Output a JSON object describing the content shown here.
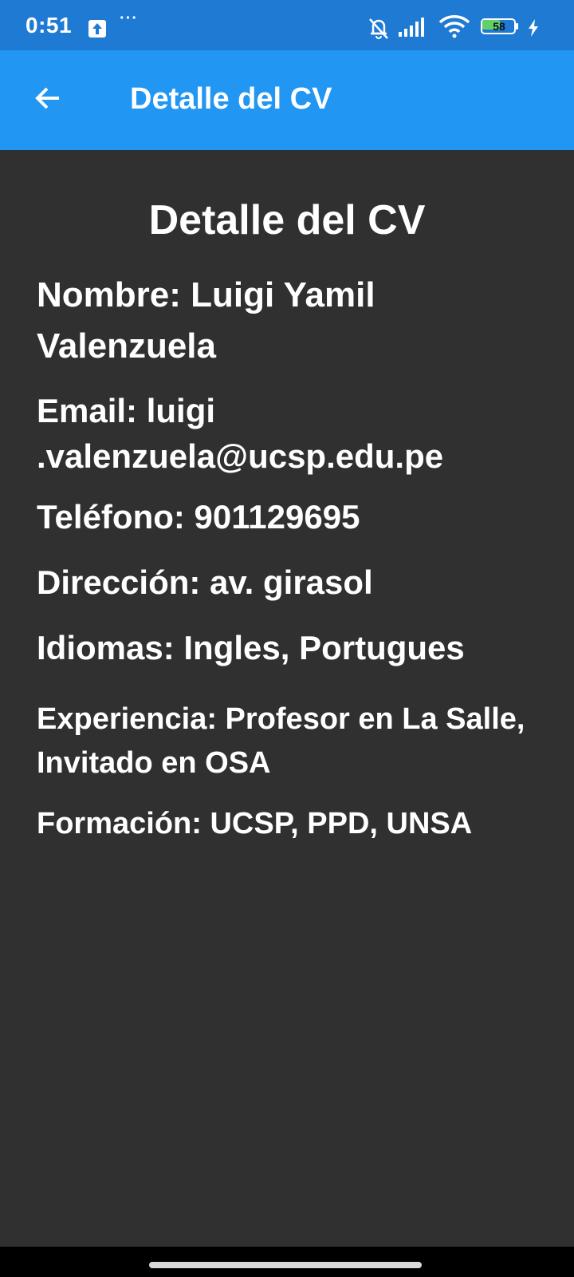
{
  "status_bar": {
    "time": "0:51",
    "battery_level": "58",
    "icons": [
      "upload-icon",
      "more-icon",
      "notifications-off-icon",
      "signal-icon",
      "wifi-icon",
      "battery-icon",
      "charging-icon"
    ]
  },
  "app_bar": {
    "title": "Detalle del CV",
    "back_icon": "arrow-back-icon",
    "color": "#2196f3"
  },
  "cv": {
    "title": "Detalle del CV",
    "nombre": "Nombre: Luigi Yamil Valenzuela",
    "email": "Email: luigi .valenzuela@ucsp.edu.pe",
    "telefono": "Teléfono: 901129695",
    "direccion": "Dirección: av. girasol",
    "idiomas": "Idiomas: Ingles, Portugues",
    "experiencia": "Experiencia: Profesor en La Salle, Invitado en OSA",
    "formacion": "Formación: UCSP, PPD, UNSA"
  },
  "colors": {
    "status_bar": "#1f7ad3",
    "background": "#303030",
    "text": "#ffffff"
  }
}
